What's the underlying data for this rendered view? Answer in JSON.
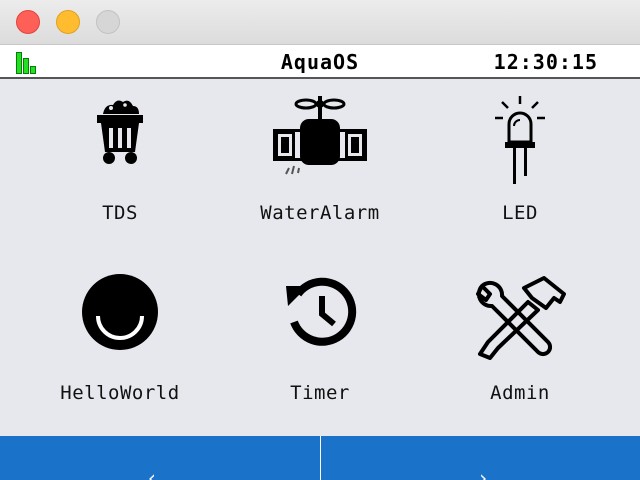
{
  "window": {
    "controls": {
      "close": "close",
      "minimize": "minimize",
      "maximize": "maximize"
    }
  },
  "status": {
    "title": "AquaOS",
    "clock": "12:30:15",
    "signal_color": "#20e020"
  },
  "apps": [
    {
      "label": "TDS",
      "icon": "mine-cart-icon"
    },
    {
      "label": "WaterAlarm",
      "icon": "sprinkler-icon"
    },
    {
      "label": "LED",
      "icon": "led-bulb-icon"
    },
    {
      "label": "HelloWorld",
      "icon": "smile-icon"
    },
    {
      "label": "Timer",
      "icon": "history-clock-icon"
    },
    {
      "label": "Admin",
      "icon": "wrench-hammer-icon"
    }
  ],
  "nav": {
    "prev_arrow": "‹",
    "next_arrow": "›",
    "bar_color": "#1a73c8"
  }
}
